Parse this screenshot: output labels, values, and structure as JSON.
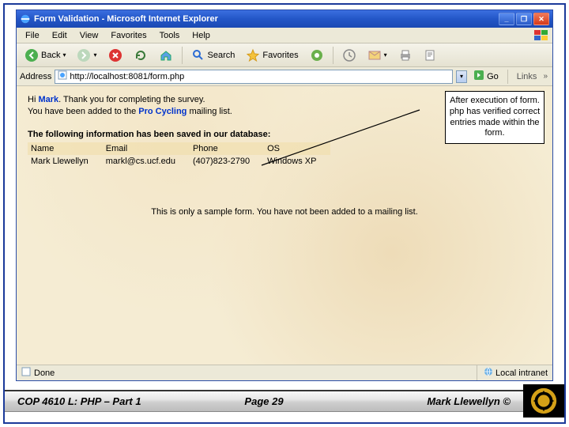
{
  "window": {
    "title": "Form Validation - Microsoft Internet Explorer",
    "min": "_",
    "max": "❐",
    "close": "✕"
  },
  "menu": {
    "file": "File",
    "edit": "Edit",
    "view": "View",
    "favorites": "Favorites",
    "tools": "Tools",
    "help": "Help"
  },
  "toolbar": {
    "back": "Back",
    "search": "Search",
    "favorites": "Favorites"
  },
  "address": {
    "label": "Address",
    "url": "http://localhost:8081/form.php",
    "go": "Go",
    "links": "Links"
  },
  "page": {
    "greeting_prefix": "Hi ",
    "greeting_name": "Mark",
    "greeting_suffix": ". Thank you for completing the survey.",
    "added_prefix": "You have been added to the ",
    "added_list": "Pro Cycling",
    "added_suffix": " mailing list.",
    "db_heading": "The following information has been saved in our database:",
    "headers": {
      "name": "Name",
      "email": "Email",
      "phone": "Phone",
      "os": "OS"
    },
    "row": {
      "name": "Mark Llewellyn",
      "email": "markl@cs.ucf.edu",
      "phone": "(407)823-2790",
      "os": "Windows XP"
    },
    "disclaimer": "This is only a sample form. You have not been added to a mailing list."
  },
  "callout": {
    "text": "After execution of form. php has verified correct entries made within the form."
  },
  "status": {
    "done": "Done",
    "zone": "Local intranet"
  },
  "footer": {
    "left": "COP 4610 L: PHP – Part 1",
    "center": "Page 29",
    "right": "Mark Llewellyn ©"
  }
}
